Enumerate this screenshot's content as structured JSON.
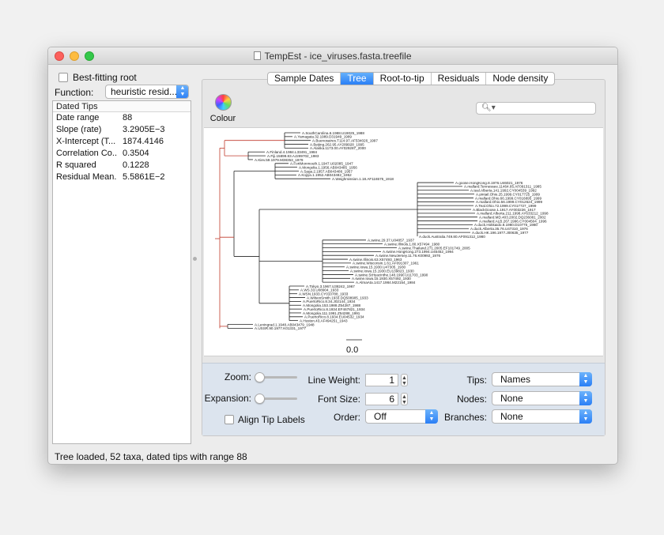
{
  "window": {
    "title": "TempEst - ice_viruses.fasta.treefile"
  },
  "sidebar": {
    "best_fitting_root_label": "Best-fitting root",
    "function_label": "Function:",
    "function_value": "heuristic resid...",
    "stats_header": "Dated Tips",
    "stats": [
      {
        "key": "Date range",
        "value": "88"
      },
      {
        "key": "Slope (rate)",
        "value": "3.2905E−3"
      },
      {
        "key": "X-Intercept (T...",
        "value": "1874.4146"
      },
      {
        "key": "Correlation Co...",
        "value": "0.3504"
      },
      {
        "key": "R squared",
        "value": "0.1228"
      },
      {
        "key": "Residual Mean...",
        "value": "5.5861E−2"
      }
    ]
  },
  "tabs": [
    {
      "label": "Sample Dates",
      "active": false
    },
    {
      "label": "Tree",
      "active": true
    },
    {
      "label": "Root-to-tip",
      "active": false
    },
    {
      "label": "Residuals",
      "active": false
    },
    {
      "label": "Node density",
      "active": false
    }
  ],
  "tree_panel": {
    "colour_label": "Colour",
    "search_placeholder": "",
    "scale_label": "0.0",
    "tips": [
      "A.SouthCarolina.6.1988.U19025_1988",
      "A.Yamagata.32.1989.D31949_1989",
      "A.Buenosaires.T114.97.AF534026_1997",
      "A.Beijing.262.95.AY289928_1995",
      "A.Alaska.1173.00.AY029287_2000",
      "A.Finland.4.1984.L33491_1984",
      "A.Fiji.15899.83.AJ289702_1983",
      "A.Kiev.59.1979.M38353_1979",
      "A.FortMonmouth.1.1947.U02085_1947",
      "A.Mongolia.1.1956.AB043485_1956",
      "A.Saga.2.1957.AB043486_1957",
      "A.Kojiya.1.1952.AB043482_1952",
      "A.Weighmission.1.18.AF116575_1918",
      "A.goose.HongKong.8.1976.U46021_1976",
      "A.mallard.Tennessee.11464.85.AF091311_1985",
      "A.teal.Alberta.141.1992.CY004539_1992",
      "A.pintail.Ohio.25.1999.CY017725_1999",
      "A.mallard.Ohio.66.1999.CY016895_1999",
      "A.mallard.Ohio.56.1999.CY012624_1999",
      "A.Teal.Ohio.72.1999.CY017727_1999",
      "A.BlackGoose.1.1917.AY003226_1917",
      "A.mallard.Alberta.211.1998.AY633212_1998",
      "A.mallard.MD.403.2002.DQ236081_2002",
      "A.mallard.ALB.267.1996.CY004504_1996",
      "A.duck.Hokkaido.8.1980.D10775_1980",
      "A.duck.Alberta.35.76.U47310_1976",
      "A.duck.HK.196.1977.J00635_1977",
      "A.duck.Australia.749.80.AF091312_1980",
      "A.swine.29.37.U04857_1937",
      "A.swine.Illinois.1.80.X57494_1980",
      "A.swine.Thailand.271.2005.EF101749_2005",
      "A.swine.HongKong.273.1994.U45452_1994",
      "A.swine.NewJersey.11.76.K00992_1976",
      "A.swine.Illinois.63.X57493_1963",
      "A.swine.Wisconsin.1.61.AF091307_1961",
      "A.swine.Iowa.15.1930.U47305_1930",
      "A.swine.Iowa.15.1930.EU139823_1930",
      "A.swine.StHyacinthe.148.1990.U11703_1990",
      "A.swine.Iowa.15.1930.X57492_1930",
      "A.AlmaAta.1417.1984.M22154_1984",
      "A.Tokyo.3.1967.U38242_1967",
      "A.WS.33.U08904_1933",
      "A.WSN.1933.CY010788_1933",
      "A.WilsonSmith.1933.DQ508905_1933",
      "A.PuertoRico.8.34.J02144_1934",
      "A.Mongolia.153.1988.Z54287_1988",
      "A.PuertoRico.8.1934.EF467821_1934",
      "A.Mongolia.111.1991.Z54288_1991",
      "A.PuertoRico.8.1934.EU04532_1934",
      "A.Huston.43.AF494251_1943",
      "A.Leningrad.1.1948.AB043479_1948",
      "A.USSR.90.1977.K01331_1977"
    ]
  },
  "controls": {
    "zoom_label": "Zoom:",
    "expansion_label": "Expansion:",
    "line_weight_label": "Line Weight:",
    "line_weight_value": "1",
    "font_size_label": "Font Size:",
    "font_size_value": "6",
    "align_label": "Align Tip Labels",
    "order_label": "Order:",
    "order_value": "Off",
    "tips_label": "Tips:",
    "tips_value": "Names",
    "nodes_label": "Nodes:",
    "nodes_value": "None",
    "branches_label": "Branches:",
    "branches_value": "None"
  },
  "status": {
    "text": "Tree loaded, 52 taxa, dated tips with range 88"
  },
  "colors": {
    "accent": "#2a7ff6",
    "tree_line": "#222222",
    "root_branch": "#c0392b"
  }
}
